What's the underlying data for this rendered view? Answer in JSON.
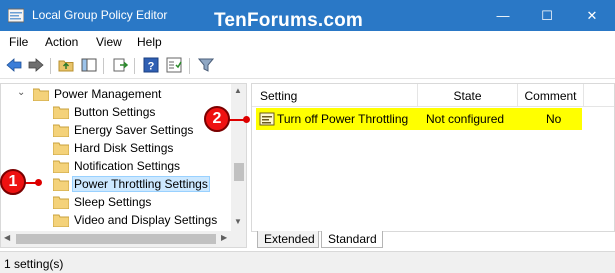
{
  "window": {
    "title": "Local Group Policy Editor",
    "watermark": "TenForums.com",
    "controls": {
      "minimize": "—",
      "maximize": "☐",
      "close": "✕"
    }
  },
  "menu": {
    "file": "File",
    "action": "Action",
    "view": "View",
    "help": "Help"
  },
  "tree": {
    "parent": "Power Management",
    "items": [
      {
        "label": "Button Settings"
      },
      {
        "label": "Energy Saver Settings"
      },
      {
        "label": "Hard Disk Settings"
      },
      {
        "label": "Notification Settings"
      },
      {
        "label": "Power Throttling Settings"
      },
      {
        "label": "Sleep Settings"
      },
      {
        "label": "Video and Display Settings"
      }
    ]
  },
  "list": {
    "columns": {
      "setting": "Setting",
      "state": "State",
      "comment": "Comment"
    },
    "rows": [
      {
        "setting": "Turn off Power Throttling",
        "state": "Not configured",
        "comment": "No"
      }
    ]
  },
  "tabs": {
    "extended": "Extended",
    "standard": "Standard"
  },
  "status": {
    "text": "1 setting(s)"
  },
  "callouts": {
    "one": "1",
    "two": "2"
  },
  "colors": {
    "titlebar": "#2a78c6",
    "highlight": "#ffff00",
    "selection": "#cce8ff",
    "callout": "#e11111"
  }
}
